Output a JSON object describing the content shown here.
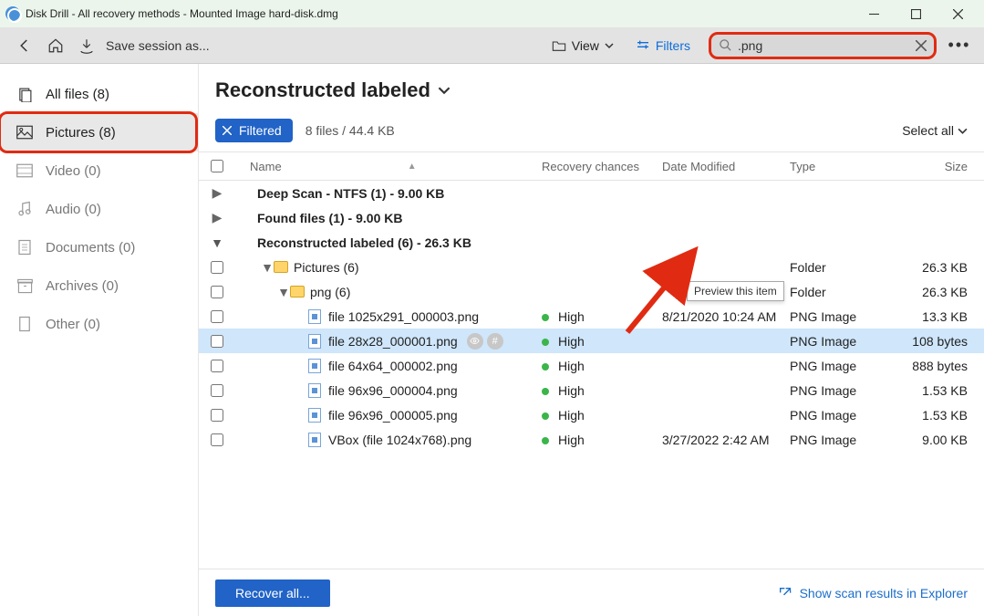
{
  "titlebar": {
    "title": "Disk Drill - All recovery methods - Mounted Image hard-disk.dmg"
  },
  "toolbar": {
    "save_session": "Save session as...",
    "view_label": "View",
    "filters_label": "Filters",
    "search_value": ".png"
  },
  "sidebar": {
    "items": [
      {
        "label": "All files (8)"
      },
      {
        "label": "Pictures (8)"
      },
      {
        "label": "Video (0)"
      },
      {
        "label": "Audio (0)"
      },
      {
        "label": "Documents (0)"
      },
      {
        "label": "Archives (0)"
      },
      {
        "label": "Other (0)"
      }
    ]
  },
  "content": {
    "folder_title": "Reconstructed labeled",
    "filtered_chip": "Filtered",
    "summary": "8 files / 44.4 KB",
    "select_all": "Select all"
  },
  "columns": {
    "name": "Name",
    "recovery": "Recovery chances",
    "date": "Date Modified",
    "type": "Type",
    "size": "Size"
  },
  "groups": [
    {
      "label": "Deep Scan - NTFS (1) - 9.00 KB"
    },
    {
      "label": "Found files (1) - 9.00 KB"
    },
    {
      "label": "Reconstructed labeled (6) - 26.3 KB"
    }
  ],
  "folders": [
    {
      "label": "Pictures (6)",
      "type": "Folder",
      "size": "26.3 KB"
    },
    {
      "label": "png (6)",
      "type": "Folder",
      "size": "26.3 KB"
    }
  ],
  "files": [
    {
      "name": "file 1025x291_000003.png",
      "rc": "High",
      "date": "8/21/2020 10:24 AM",
      "type": "PNG Image",
      "size": "13.3 KB"
    },
    {
      "name": "file 28x28_000001.png",
      "rc": "High",
      "date": "",
      "type": "PNG Image",
      "size": "108 bytes"
    },
    {
      "name": "file 64x64_000002.png",
      "rc": "High",
      "date": "",
      "type": "PNG Image",
      "size": "888 bytes"
    },
    {
      "name": "file 96x96_000004.png",
      "rc": "High",
      "date": "",
      "type": "PNG Image",
      "size": "1.53 KB"
    },
    {
      "name": "file 96x96_000005.png",
      "rc": "High",
      "date": "",
      "type": "PNG Image",
      "size": "1.53 KB"
    },
    {
      "name": "VBox (file 1024x768).png",
      "rc": "High",
      "date": "3/27/2022 2:42 AM",
      "type": "PNG Image",
      "size": "9.00 KB"
    }
  ],
  "tooltip": {
    "preview": "Preview this item"
  },
  "footer": {
    "recover": "Recover all...",
    "explorer": "Show scan results in Explorer"
  }
}
